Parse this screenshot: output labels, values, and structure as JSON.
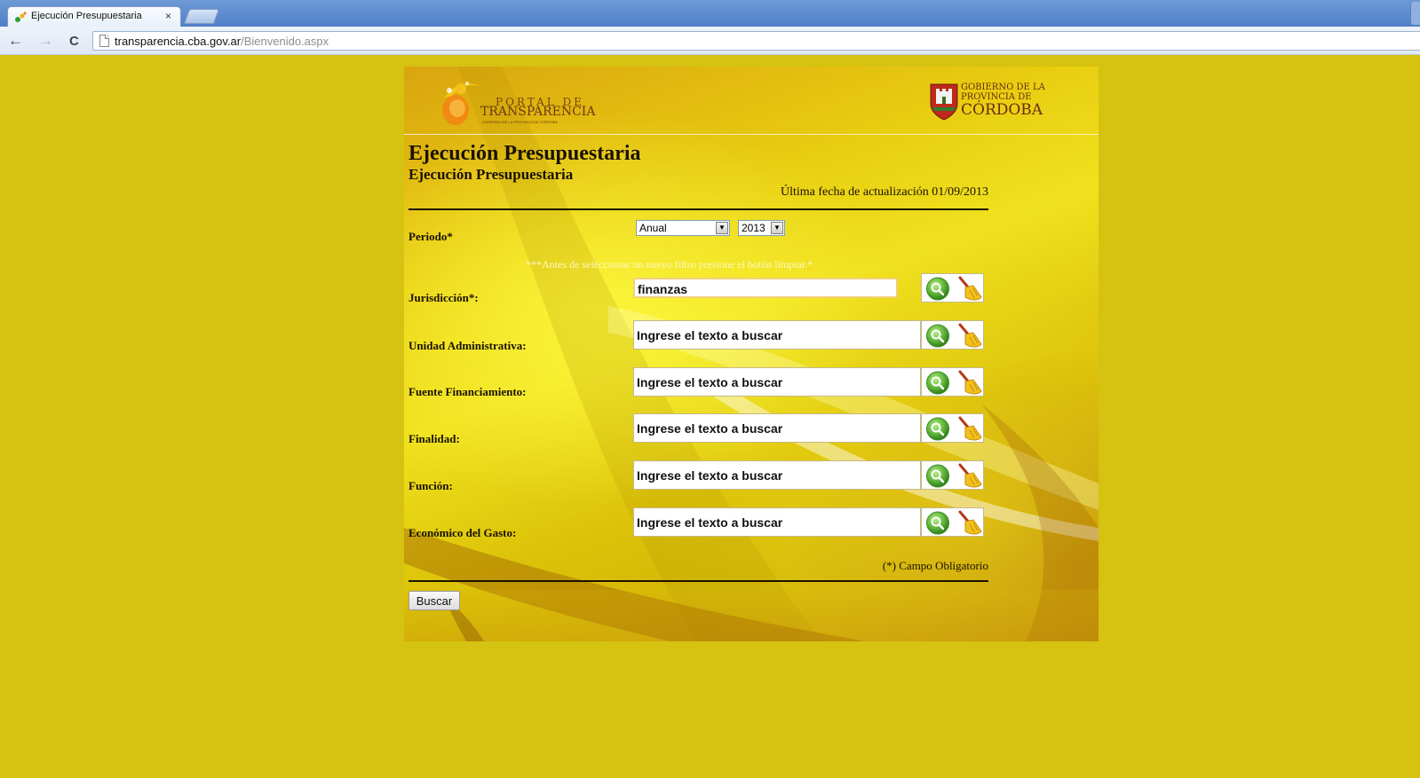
{
  "browser": {
    "tab_title": "Ejecución Presupuestaria",
    "tab_close": "×",
    "url_host": "transparencia.cba.gov.ar",
    "url_path": "/Bienvenido.aspx",
    "back": "←",
    "forward": "→",
    "reload": "C"
  },
  "header": {
    "portal_top": "PORTAL DE",
    "portal_main": "TRANSPARENCIA",
    "portal_tagline": "GOBIERNO DE LA PROVINCIA DE CÓRDOBA",
    "gov_line1": "GOBIERNO DE LA",
    "gov_line2": "PROVINCIA DE",
    "gov_main": "CÓRDOBA"
  },
  "page": {
    "title": "Ejecución Presupuestaria",
    "subtitle": "Ejecución Presupuestaria",
    "last_update": "Última fecha de actualización 01/09/2013"
  },
  "periodo": {
    "label": "Periodo*",
    "period_value": "Anual",
    "year_value": "2013"
  },
  "note": "***Antes de seleccionar un nuevo filtro presione el botón limpiar.*",
  "filters": [
    {
      "label": "Jurisdicción*:",
      "value": "finanzas"
    },
    {
      "label": "Unidad Administrativa:",
      "value": "Ingrese el texto a buscar"
    },
    {
      "label": "Fuente Financiamiento:",
      "value": "Ingrese el texto a buscar"
    },
    {
      "label": "Finalidad:",
      "value": "Ingrese el texto a buscar"
    },
    {
      "label": "Función:",
      "value": "Ingrese el texto a buscar"
    },
    {
      "label": "Económico del Gasto:",
      "value": "Ingrese el texto a buscar"
    }
  ],
  "required_note": "(*) Campo Obligatorio",
  "search_button": "Buscar",
  "colors": {
    "page_background": "#d5c211",
    "text_dark": "#1a1200",
    "search_icon": "#5fb53a",
    "logo_orange": "#f08a12"
  },
  "icons": [
    "search-icon",
    "broom-icon",
    "crest-icon",
    "portal-logo-icon"
  ]
}
